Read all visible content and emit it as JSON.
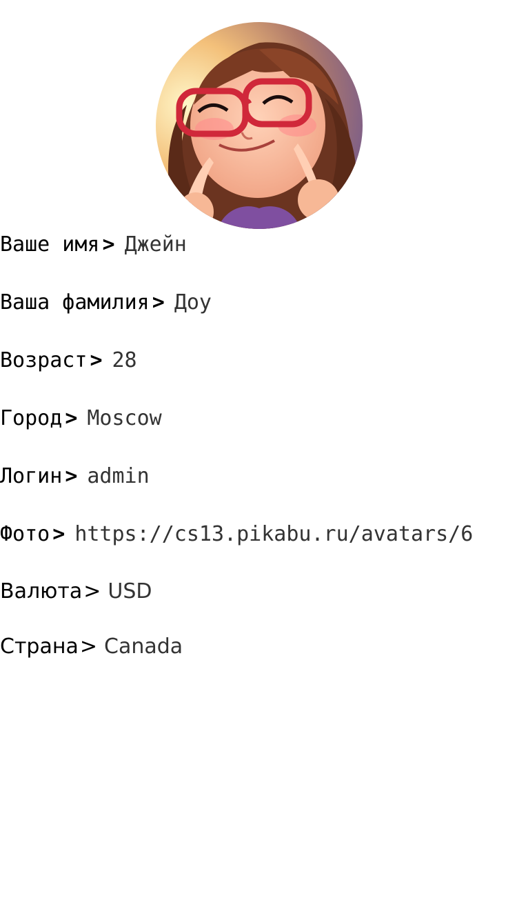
{
  "profile": {
    "avatar_alt": "user-avatar",
    "fields": [
      {
        "label": "Ваше имя",
        "arrow": ">",
        "value": "Джейн"
      },
      {
        "label": "Ваша фамилия",
        "arrow": ">",
        "value": "Доу"
      },
      {
        "label": "Возраст",
        "arrow": ">",
        "value": "28"
      },
      {
        "label": "Город",
        "arrow": ">",
        "value": "Moscow"
      },
      {
        "label": "Логин",
        "arrow": ">",
        "value": "admin"
      },
      {
        "label": "Фото",
        "arrow": ">",
        "value": "https://cs13.pikabu.ru/avatars/6"
      },
      {
        "label": "Валюта",
        "arrow": ">",
        "value": "USD"
      },
      {
        "label": "Страна",
        "arrow": ">",
        "value": "Canada"
      }
    ]
  }
}
